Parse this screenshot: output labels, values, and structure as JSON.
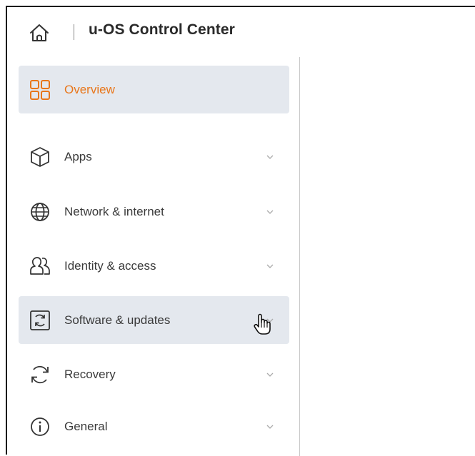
{
  "header": {
    "title": "u-OS Control Center",
    "home_icon": "home-icon"
  },
  "colors": {
    "accent": "#e8761a",
    "highlight_bg": "#e4e8ee"
  },
  "sidebar": {
    "items": [
      {
        "label": "Overview",
        "icon": "overview-grid-icon",
        "active": true,
        "expandable": false
      },
      {
        "label": "Apps",
        "icon": "cube-icon",
        "active": false,
        "expandable": true
      },
      {
        "label": "Network & internet",
        "icon": "globe-icon",
        "active": false,
        "expandable": true
      },
      {
        "label": "Identity & access",
        "icon": "users-icon",
        "active": false,
        "expandable": true
      },
      {
        "label": "Software & updates",
        "icon": "software-update-icon",
        "active": false,
        "expandable": true,
        "hovered": true
      },
      {
        "label": "Recovery",
        "icon": "refresh-icon",
        "active": false,
        "expandable": true
      },
      {
        "label": "General",
        "icon": "info-icon",
        "active": false,
        "expandable": true
      }
    ]
  }
}
